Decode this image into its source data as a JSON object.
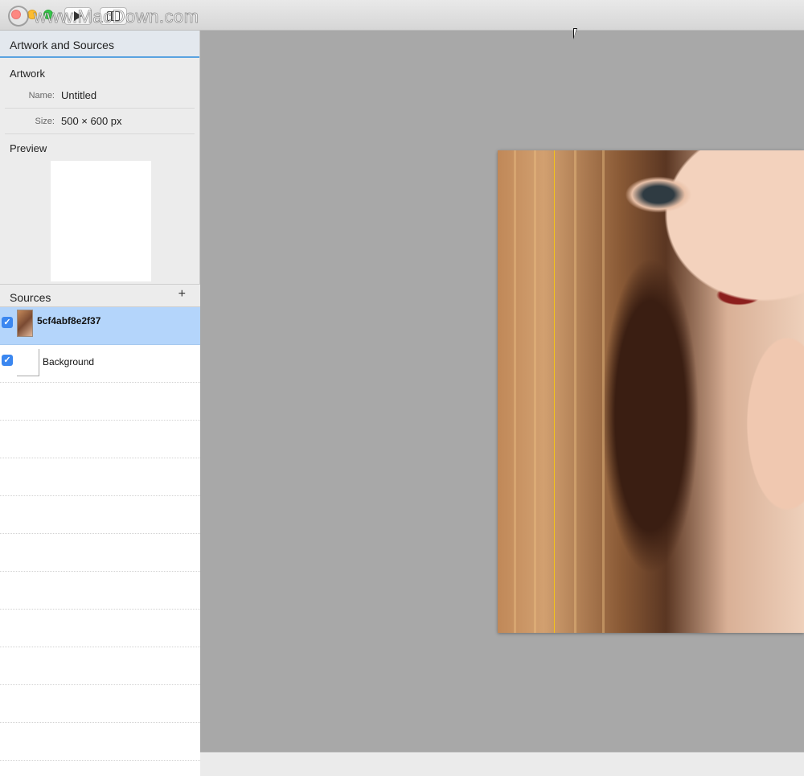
{
  "window": {
    "watermark": "www.MacDown.com"
  },
  "toolbar": {
    "play_icon": "play-icon",
    "sidebar_icon": "sidebar-icon"
  },
  "panel": {
    "header": "Artwork and Sources",
    "artwork_section": "Artwork",
    "name_label": "Name:",
    "name_value": "Untitled",
    "size_label": "Size:",
    "size_value": "500 × 600 px",
    "preview_section": "Preview"
  },
  "sources": {
    "header": "Sources",
    "add_label": "+",
    "items": [
      {
        "name": "5cf4abf8e2f37",
        "checked": true,
        "selected": true
      },
      {
        "name": "Background",
        "checked": true,
        "selected": false
      }
    ]
  },
  "colors": {
    "selection": "#b4d5fb",
    "guide": "#f2c21b",
    "canvas": "#a8a8a8",
    "accent": "#3b87f0"
  }
}
